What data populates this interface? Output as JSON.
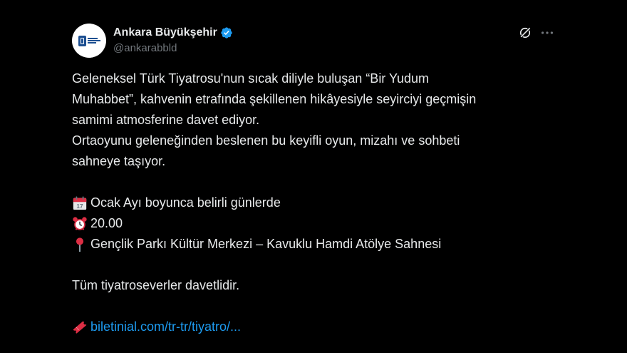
{
  "account": {
    "display_name": "Ankara Büyükşehir",
    "handle": "@ankarabbld",
    "verified_color": "#1d9bf0"
  },
  "icons": {
    "verified": "verified-badge-icon",
    "grok": "grok-icon",
    "more": "more-options-icon",
    "calendar": "calendar-emoji-icon",
    "clock": "alarm-clock-emoji-icon",
    "pin": "round-pushpin-emoji-icon",
    "ticket": "ticket-emoji-icon"
  },
  "tweet": {
    "paragraph1_line1": "Geleneksel Türk Tiyatrosu'nun sıcak diliyle buluşan “Bir Yudum",
    "paragraph1_line2": "Muhabbet”, kahvenin etrafında şekillenen hikâyesiyle seyirciyi geçmişin",
    "paragraph1_line3": "samimi atmosferine davet ediyor.",
    "paragraph2_line1": "Ortaoyunu geleneğinden beslenen bu keyifli oyun, mizahı ve sohbeti",
    "paragraph2_line2": "sahneye taşıyor.",
    "date_text": "Ocak Ayı boyunca belirli günlerde",
    "calendar_day": "17",
    "time_text": "20.00",
    "place_text": "Gençlik Parkı Kültür Merkezi – Kavuklu Hamdi Atölye Sahnesi",
    "closing": "Tüm tiyatroseverler davetlidir.",
    "link_text": "biletinial.com/tr-tr/tiyatro/..."
  },
  "colors": {
    "background": "#000000",
    "text": "#e7e9ea",
    "muted": "#71767b",
    "link": "#1d9bf0"
  }
}
